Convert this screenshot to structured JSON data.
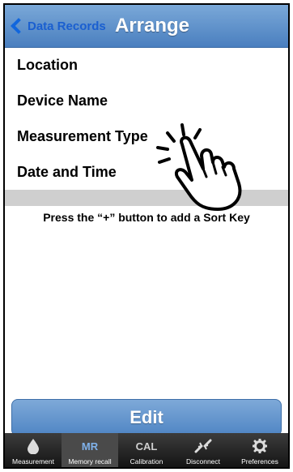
{
  "navbar": {
    "back_label": "Data Records",
    "title": "Arrange"
  },
  "sort_keys": [
    {
      "label": "Location"
    },
    {
      "label": "Device Name"
    },
    {
      "label": "Measurement Type"
    },
    {
      "label": "Date and Time"
    }
  ],
  "hint": "Press the “+” button to add a Sort Key",
  "edit_button": "Edit",
  "tabs": [
    {
      "label": "Measurement",
      "icon": "drop-icon",
      "icon_text": ""
    },
    {
      "label": "Memory recall",
      "icon": "mr-icon",
      "icon_text": "MR",
      "active": true
    },
    {
      "label": "Calibration",
      "icon": "cal-icon",
      "icon_text": "CAL"
    },
    {
      "label": "Disconnect",
      "icon": "disconnect-icon",
      "icon_text": ""
    },
    {
      "label": "Preferences",
      "icon": "gear-icon",
      "icon_text": ""
    }
  ],
  "colors": {
    "navbar": "#4a7fbf",
    "back_chevron": "#1166dd",
    "tabbar": "#141414",
    "active_tab": "#4a4a4a"
  }
}
